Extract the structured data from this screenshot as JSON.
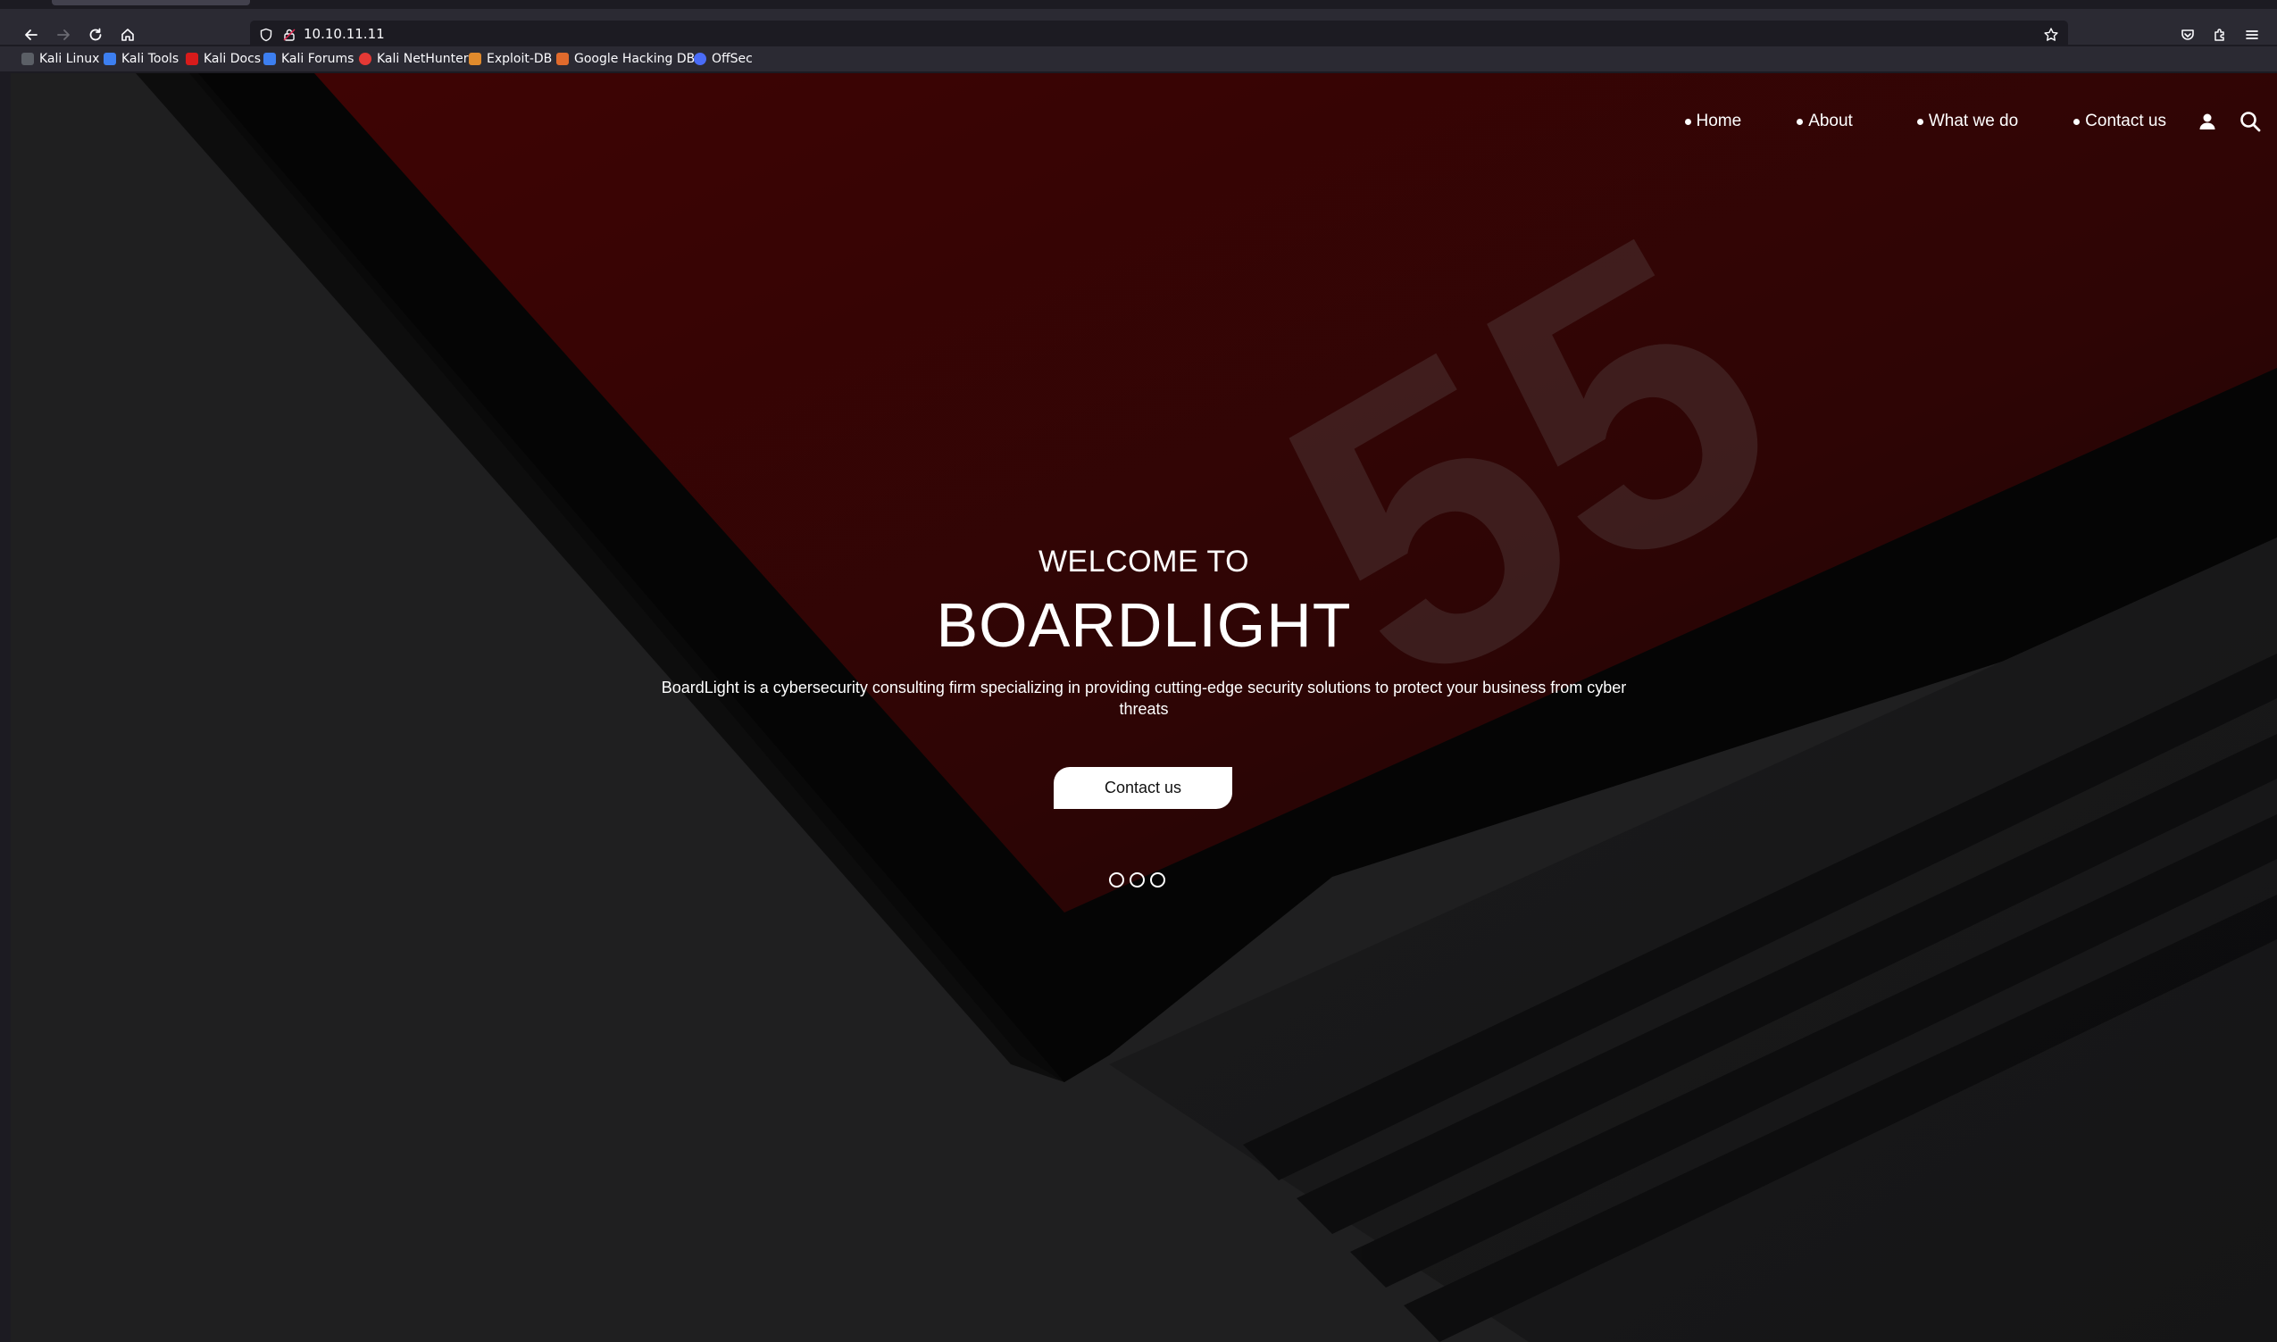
{
  "browser": {
    "url": "10.10.11.11",
    "bookmarks": [
      {
        "label": "Kali Linux",
        "color": "#9aa0a6"
      },
      {
        "label": "Kali Tools",
        "color": "#3d7ff0"
      },
      {
        "label": "Kali Docs",
        "color": "#d81b1b"
      },
      {
        "label": "Kali Forums",
        "color": "#3d7ff0"
      },
      {
        "label": "Kali NetHunter",
        "color": "#e53935"
      },
      {
        "label": "Exploit-DB",
        "color": "#e08a2c"
      },
      {
        "label": "Google Hacking DB",
        "color": "#e06a2c"
      },
      {
        "label": "OffSec",
        "color": "#4a6cf7"
      }
    ]
  },
  "nav": {
    "items": [
      "Home",
      "About",
      "What we do",
      "Contact us"
    ]
  },
  "hero": {
    "welcome": "WELCOME TO",
    "brand": "BOARDLIGHT",
    "tagline": "BoardLight is a cybersecurity consulting firm specializing in providing cutting-edge security solutions to protect your business from cyber threats",
    "cta_label": "Contact us",
    "slide_count": 3,
    "background_text": "55"
  },
  "colors": {
    "accent_red": "#3a0505",
    "text": "#ffffff"
  }
}
